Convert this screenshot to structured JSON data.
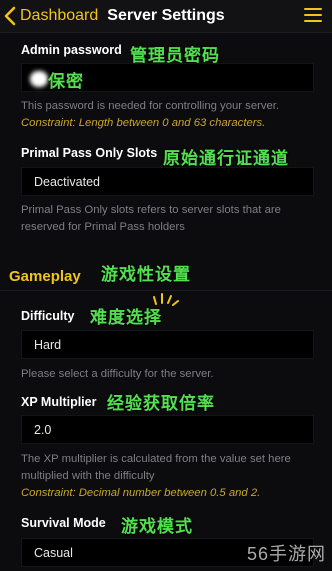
{
  "nav": {
    "back_label": "Dashboard",
    "title": "Server Settings"
  },
  "admin": {
    "label": "Admin password",
    "annotation": "管理员密码",
    "value_annotation": "保密",
    "help": "This password is needed for controlling your server.",
    "constraint": "Constraint: Length between 0 and 63 characters."
  },
  "primal": {
    "label": "Primal Pass Only Slots",
    "annotation": "原始通行证通道",
    "value": "Deactivated",
    "help": "Primal Pass Only slots refers to server slots that are reserved for Primal Pass holders"
  },
  "gameplay": {
    "section_title": "Gameplay",
    "annotation": "游戏性设置"
  },
  "difficulty": {
    "label": "Difficulty",
    "annotation": "难度选择",
    "value": "Hard",
    "help": "Please select a difficulty for the server."
  },
  "xp": {
    "label": "XP Multiplier",
    "annotation": "经验获取倍率",
    "value": "2.0",
    "help": "The XP multiplier is calculated from the value set here multiplied with the difficulty",
    "constraint": "Constraint: Decimal number between 0.5 and 2."
  },
  "survival": {
    "label": "Survival Mode",
    "annotation": "游戏模式",
    "value": "Casual"
  },
  "watermark": "56手游网",
  "colors": {
    "accent": "#f2c318",
    "annotation": "#52e050",
    "background": "#0c0c0e"
  }
}
